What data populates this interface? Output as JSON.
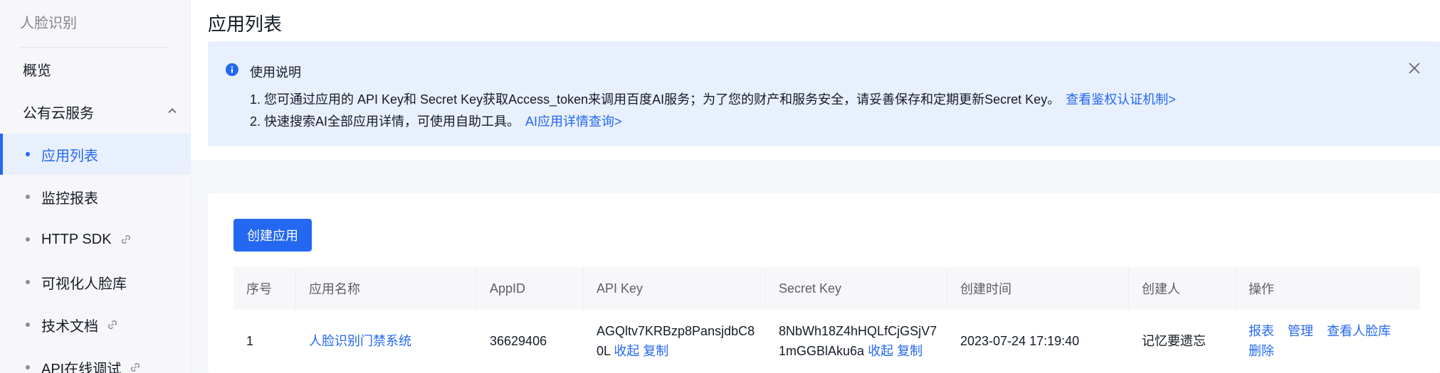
{
  "sidebar": {
    "title": "人脸识别",
    "overview": "概览",
    "group_label": "公有云服务",
    "items": [
      {
        "label": "应用列表"
      },
      {
        "label": "监控报表"
      },
      {
        "label": "HTTP SDK"
      },
      {
        "label": "可视化人脸库"
      },
      {
        "label": "技术文档"
      },
      {
        "label": "API在线调试"
      }
    ]
  },
  "page": {
    "title": "应用列表"
  },
  "notice": {
    "title": "使用说明",
    "line1": "1. 您可通过应用的 API Key和 Secret Key获取Access_token来调用百度AI服务；为了您的财产和服务安全，请妥善保存和定期更新Secret Key。",
    "line1_link": "查看鉴权认证机制>",
    "line2": "2. 快速搜索AI全部应用详情，可使用自助工具。",
    "line2_link": "AI应用详情查询>"
  },
  "card": {
    "create_button": "创建应用"
  },
  "table": {
    "headers": [
      "序号",
      "应用名称",
      "AppID",
      "API Key",
      "Secret Key",
      "创建时间",
      "创建人",
      "操作"
    ],
    "rows": [
      {
        "index": "1",
        "name": "人脸识别门禁系统",
        "appid": "36629406",
        "api_key_line1": "AGQltv7KRBzp8PansjdbC8",
        "api_key_line2": "0L",
        "secret_key_line1": "8NbWh18Z4hHQLfCjGSjV7",
        "secret_key_line2": "1mGGBlAku6a",
        "collapse": "收起",
        "copy": "复制",
        "created_at": "2023-07-24 17:19:40",
        "creator": "记忆要遗忘",
        "ops": [
          "报表",
          "管理",
          "查看人脸库",
          "删除"
        ]
      }
    ]
  },
  "colors": {
    "accent": "#2468f2",
    "notice_bg": "#e8f0fd"
  }
}
